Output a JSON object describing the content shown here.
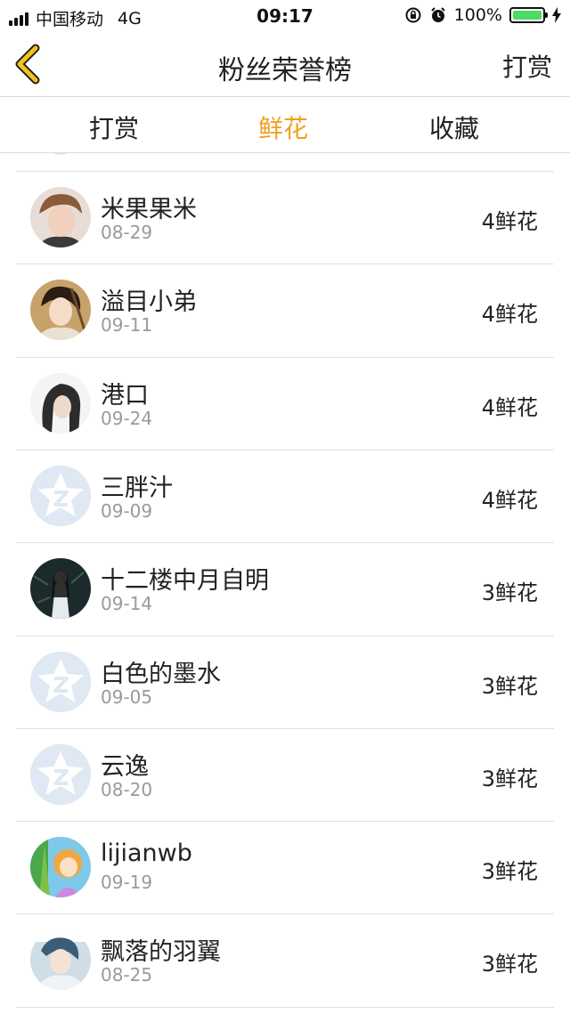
{
  "status_bar": {
    "carrier": "中国移动",
    "network": "4G",
    "time": "09:17",
    "battery": "100%",
    "battery_level": 1.0
  },
  "navbar": {
    "title": "粉丝荣誉榜",
    "right_label": "打赏"
  },
  "tabs": [
    {
      "label": "打赏",
      "active": false
    },
    {
      "label": "鲜花",
      "active": true
    },
    {
      "label": "收藏",
      "active": false
    }
  ],
  "colors": {
    "accent": "#f0a01e",
    "back_icon": "#f0c419",
    "battery_green": "#4cd964",
    "default_avatar_bg": "#dfe8f3"
  },
  "fans": [
    {
      "name": "米果果米",
      "date": "08-29",
      "count": "4鲜花",
      "avatar": "photo-boy-avatar"
    },
    {
      "name": "溢目小弟",
      "date": "09-11",
      "count": "4鲜花",
      "avatar": "photo-swordsman-avatar"
    },
    {
      "name": "港口",
      "date": "09-24",
      "count": "4鲜花",
      "avatar": "photo-longhair-avatar"
    },
    {
      "name": "三胖汁",
      "date": "09-09",
      "count": "4鲜花",
      "avatar": "default-qq-star-avatar"
    },
    {
      "name": "十二楼中月自明",
      "date": "09-14",
      "count": "3鲜花",
      "avatar": "photo-dark-figure-avatar"
    },
    {
      "name": "白色的墨水",
      "date": "09-05",
      "count": "3鲜花",
      "avatar": "default-qq-star-avatar"
    },
    {
      "name": "云逸",
      "date": "08-20",
      "count": "3鲜花",
      "avatar": "default-qq-star-avatar"
    },
    {
      "name": "lijianwb",
      "date": "09-19",
      "count": "3鲜花",
      "avatar": "cartoon-girl-avatar"
    },
    {
      "name": "飘落的羽翼",
      "date": "08-25",
      "count": "3鲜花",
      "avatar": "anime-character-avatar"
    }
  ]
}
